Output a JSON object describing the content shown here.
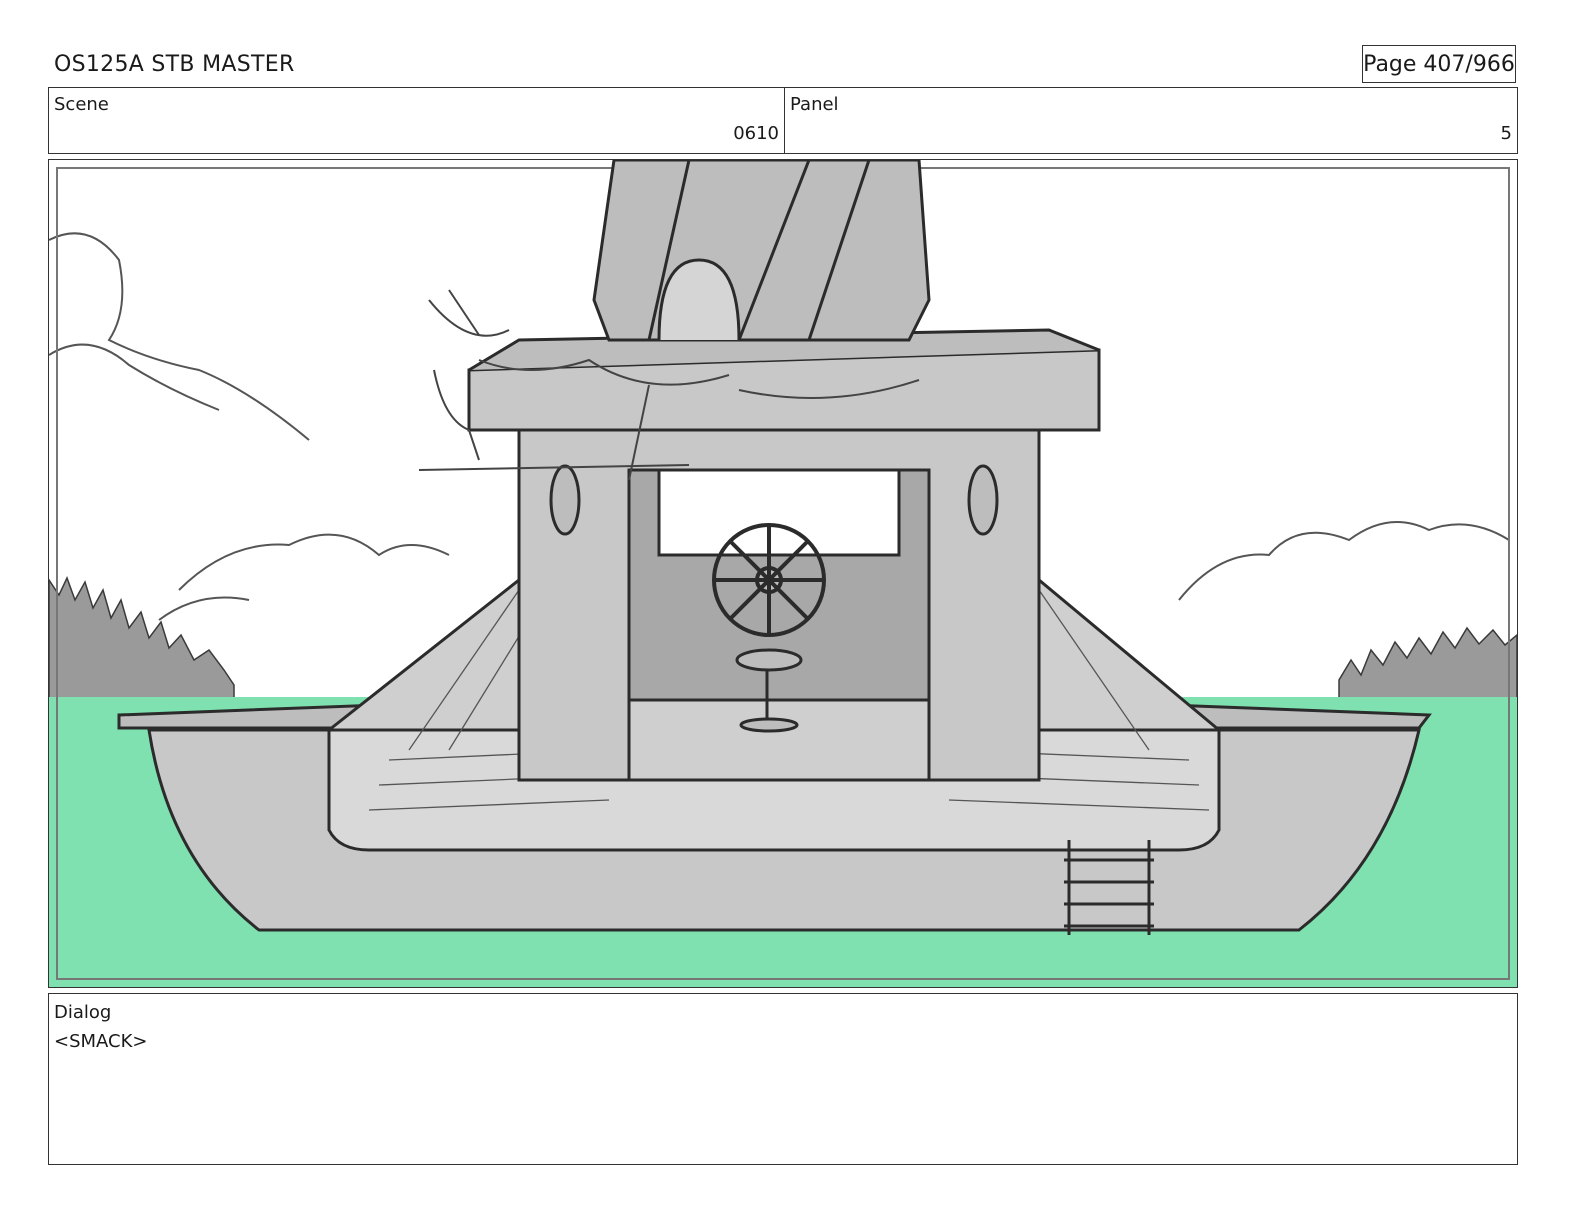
{
  "header": {
    "title": "OS125A  STB MASTER",
    "page": "Page 407/966"
  },
  "scene": {
    "label": "Scene",
    "value": "0610"
  },
  "panel": {
    "label": "Panel",
    "value": "5"
  },
  "dialog": {
    "label": "Dialog",
    "text": "<SMACK>"
  },
  "colors": {
    "water": "#7fe0b0",
    "sketch_fill": "#c8c8c8",
    "sketch_dark": "#9a9a9a",
    "line": "#2b2b2b"
  }
}
